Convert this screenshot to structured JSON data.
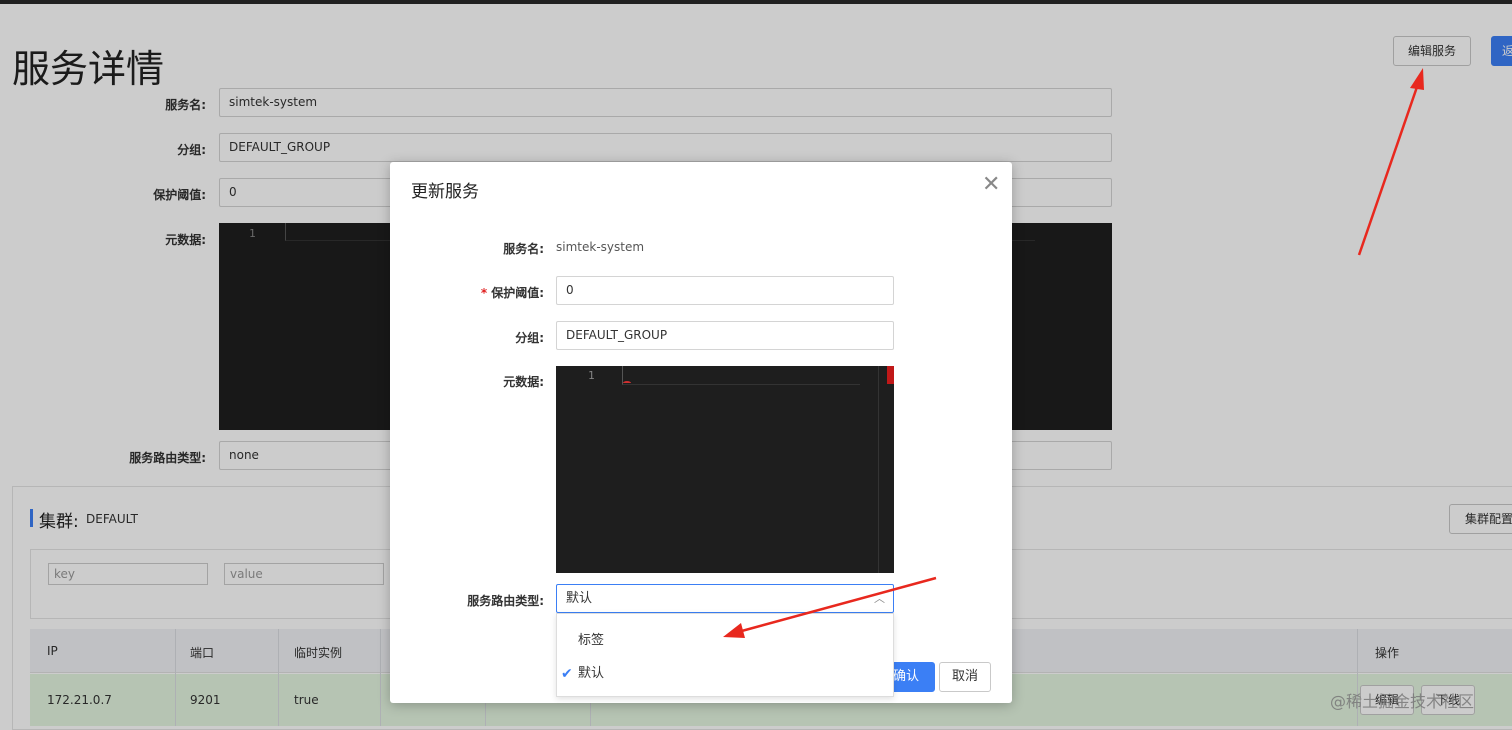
{
  "page": {
    "title": "服务详情",
    "edit_button": "编辑服务",
    "back_button": "返",
    "fields": {
      "service_name_label": "服务名:",
      "service_name_value": "simtek-system",
      "group_label": "分组:",
      "group_value": "DEFAULT_GROUP",
      "threshold_label": "保护阈值:",
      "threshold_value": "0",
      "metadata_label": "元数据:",
      "metadata_line": "1",
      "selector_label": "服务路由类型:",
      "selector_value": "none"
    }
  },
  "cluster": {
    "title": "集群:",
    "name": "DEFAULT",
    "config_button": "集群配置",
    "filter_key_placeholder": "key",
    "filter_value_placeholder": "value",
    "columns": [
      "IP",
      "端口",
      "临时实例",
      "操作"
    ],
    "rows": [
      {
        "ip": "172.21.0.7",
        "port": "9201",
        "ephemeral": "true",
        "edit": "编辑",
        "offline": "下线"
      }
    ]
  },
  "dialog": {
    "title": "更新服务",
    "close_icon": "close-icon",
    "service_name_label": "服务名:",
    "service_name_value": "simtek-system",
    "threshold_required": "*",
    "threshold_label": "保护阈值:",
    "threshold_value": "0",
    "group_label": "分组:",
    "group_value": "DEFAULT_GROUP",
    "metadata_label": "元数据:",
    "metadata_line": "1",
    "selector_label": "服务路由类型:",
    "selector_value": "默认",
    "selector_options": [
      "标签",
      "默认"
    ],
    "selected_index": 1,
    "confirm_button": "确认",
    "cancel_button": "取消"
  },
  "watermark": "@稀土掘金技术社区",
  "colors": {
    "primary": "#3b7ff5",
    "annotation_arrow": "#e8281e",
    "row_highlight": "#e4f6e0"
  }
}
